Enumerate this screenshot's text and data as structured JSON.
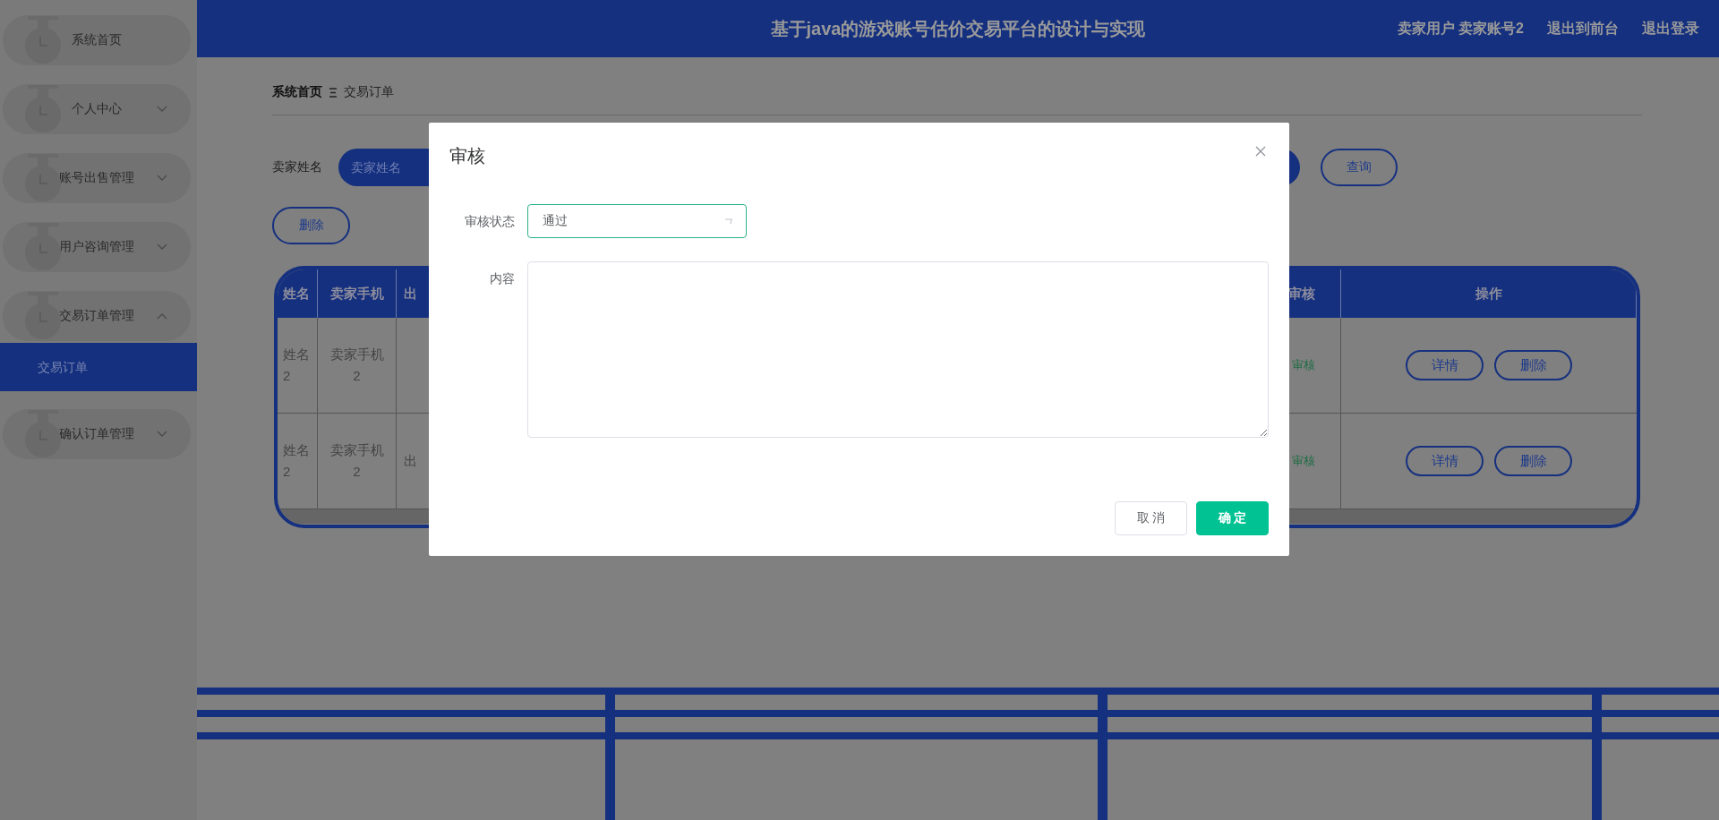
{
  "header": {
    "title": "基于java的游戏账号估价交易平台的设计与实现",
    "user": "卖家用户 卖家账号2",
    "links": [
      "退出到前台",
      "退出登录"
    ]
  },
  "sidebar": {
    "items": [
      {
        "label": "系统首页",
        "kind": "link",
        "selected": false
      },
      {
        "label": "个人中心",
        "kind": "group",
        "expanded": false,
        "selected": false
      },
      {
        "label": "账号出售管理",
        "kind": "group",
        "expanded": false,
        "selected": false
      },
      {
        "label": "用户咨询管理",
        "kind": "group",
        "expanded": false,
        "selected": false
      },
      {
        "label": "交易订单管理",
        "kind": "group",
        "expanded": true,
        "selected": false,
        "children": [
          {
            "label": "交易订单",
            "selected": true
          }
        ]
      },
      {
        "label": "确认订单管理",
        "kind": "group",
        "expanded": false,
        "selected": false
      }
    ]
  },
  "breadcrumb": [
    "系统首页",
    "交易订单"
  ],
  "search": {
    "label": "卖家姓名",
    "placeholder": "卖家姓名",
    "button": "查询"
  },
  "delete_button": "删除",
  "table": {
    "columns": [
      "姓名",
      "卖家手机",
      "出",
      "审核",
      "操作"
    ],
    "rows": [
      {
        "column_1": "姓名2",
        "column_2": "卖家手机2",
        "column_4": "审核",
        "actions": [
          "详情",
          "删除"
        ]
      },
      {
        "column_1": "姓名2",
        "column_2": "卖家手机2",
        "column_3": "出",
        "column_4": "审核",
        "actions": [
          "详情",
          "删除"
        ]
      }
    ]
  },
  "dialog": {
    "title": "审核",
    "fields": [
      {
        "kind": "select",
        "label": "审核状态",
        "value": "通过"
      },
      {
        "kind": "textarea",
        "label": "内容"
      }
    ],
    "buttons": [
      {
        "label": "取 消",
        "kind": "cancel"
      },
      {
        "label": "确 定",
        "kind": "primary"
      }
    ]
  }
}
